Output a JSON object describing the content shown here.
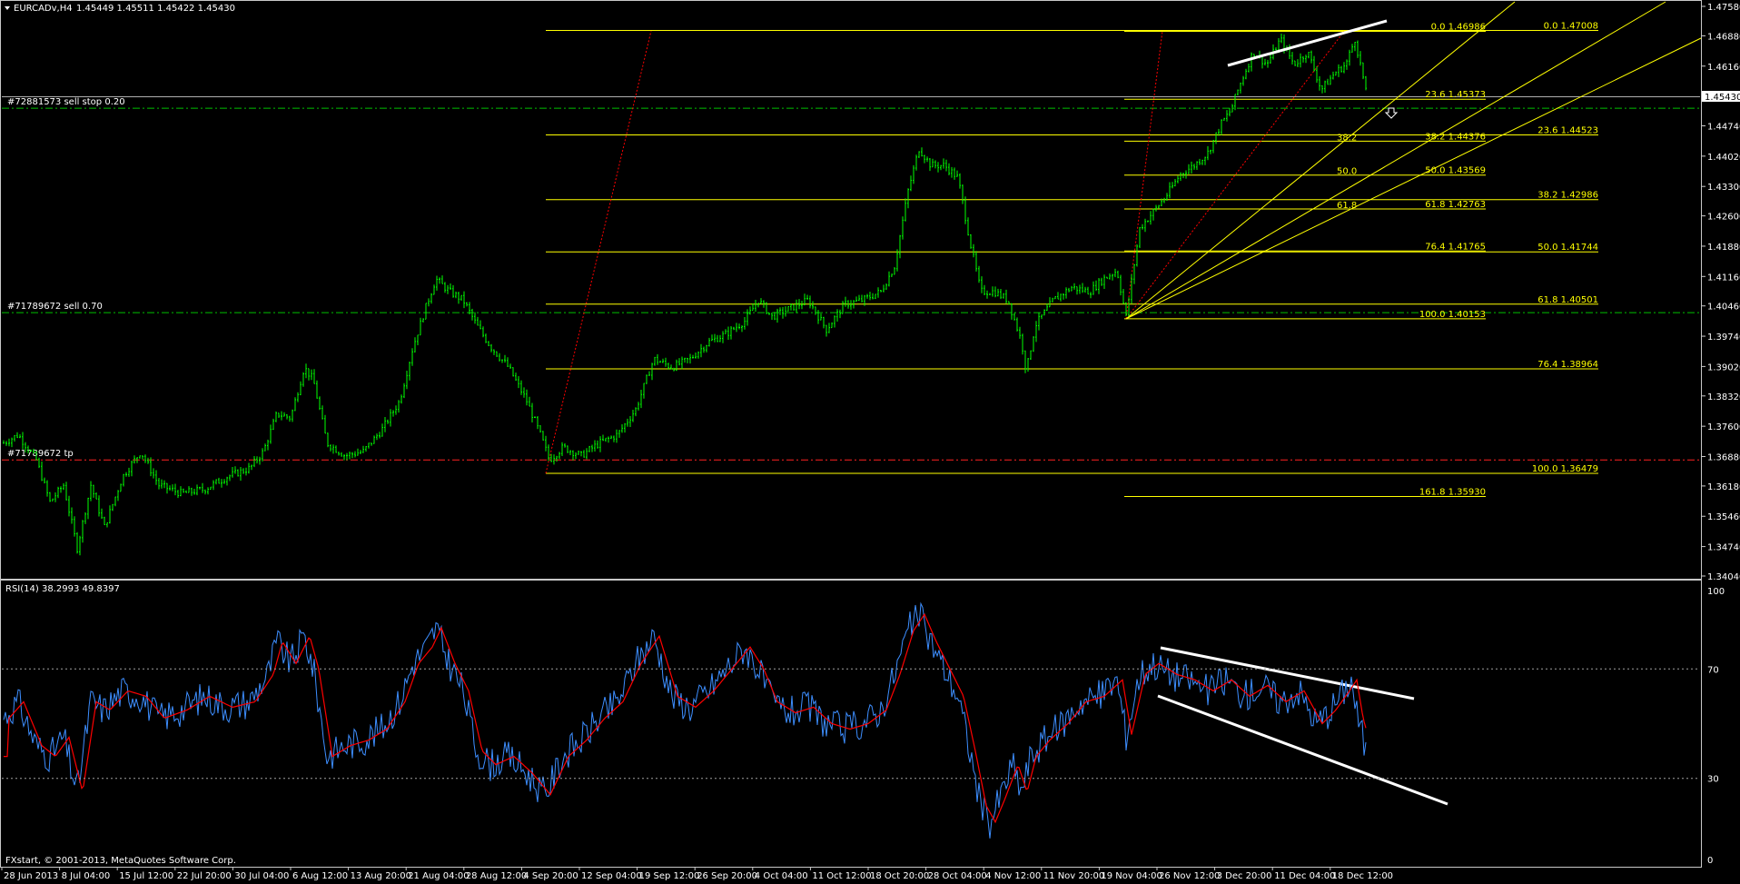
{
  "main_header": {
    "symbol": "EURCADv,H4",
    "ohlc": "1.45449 1.45511 1.45422 1.45430"
  },
  "rsi_header": {
    "label": "RSI(14) 38.2993 49.8397"
  },
  "copyright": "FXstart, © 2001-2013, MetaQuotes Software Corp.",
  "current_price": "1.45430",
  "price_axis": [
    "1.47580",
    "1.46880",
    "1.46160",
    "1.45430",
    "1.44740",
    "1.44020",
    "1.43300",
    "1.42600",
    "1.41880",
    "1.41160",
    "1.40460",
    "1.39740",
    "1.39020",
    "1.38320",
    "1.37600",
    "1.36880",
    "1.36180",
    "1.35460",
    "1.34740",
    "1.34040"
  ],
  "rsi_axis": [
    "100",
    "70",
    "30",
    "0"
  ],
  "time_axis": [
    "28 Jun 2013",
    "8 Jul 04:00",
    "15 Jul 12:00",
    "22 Jul 20:00",
    "30 Jul 04:00",
    "6 Aug 12:00",
    "13 Aug 20:00",
    "21 Aug 04:00",
    "28 Aug 12:00",
    "4 Sep 20:00",
    "12 Sep 04:00",
    "19 Sep 12:00",
    "26 Sep 20:00",
    "4 Oct 04:00",
    "11 Oct 12:00",
    "18 Oct 20:00",
    "28 Oct 04:00",
    "4 Nov 12:00",
    "11 Nov 20:00",
    "19 Nov 04:00",
    "26 Nov 12:00",
    "3 Dec 20:00",
    "11 Dec 04:00",
    "18 Dec 12:00"
  ],
  "orders": [
    {
      "label": "#72881573 sell stop 0.20",
      "price": 1.4516,
      "color": "#00c000"
    },
    {
      "label": "#71789672 sell 0.70",
      "price": 1.403,
      "color": "#00c000"
    },
    {
      "label": "#71789672 tp",
      "price": 1.368,
      "color": "#ff2020"
    }
  ],
  "fib_levels_a": [
    {
      "label": "0.0  1.47008",
      "price": 1.47008
    },
    {
      "label": "23.6  1.44523",
      "price": 1.44523
    },
    {
      "label": "38.2  1.42986",
      "price": 1.42986
    },
    {
      "label": "50.0  1.41744",
      "price": 1.41744
    },
    {
      "label": "61.8  1.40501",
      "price": 1.40501
    },
    {
      "label": "76.4  1.38964",
      "price": 1.38964
    },
    {
      "label": "100.0  1.36479",
      "price": 1.36479
    }
  ],
  "fib_levels_b": [
    {
      "label": "0.0  1.46986",
      "price": 1.46986
    },
    {
      "label": "23.6  1.45373",
      "price": 1.45373
    },
    {
      "label": "38.2  1.44376",
      "price": 1.44376
    },
    {
      "label": "50.0  1.43569",
      "price": 1.43569
    },
    {
      "label": "61.8  1.42763",
      "price": 1.42763
    },
    {
      "label": "76.4  1.41765",
      "price": 1.41765
    },
    {
      "label": "100.0  1.40153",
      "price": 1.40153
    },
    {
      "label": "161.8  1.35930",
      "price": 1.3593
    }
  ],
  "fan_labels": [
    "38.2",
    "50.0",
    "61.8"
  ],
  "colors": {
    "candles": "#00ff00",
    "fib": "#ffff00",
    "rsi": "#3d8eff",
    "rsi_signal": "#ff0000",
    "trendline": "#ffffff",
    "background": "#000000"
  }
}
